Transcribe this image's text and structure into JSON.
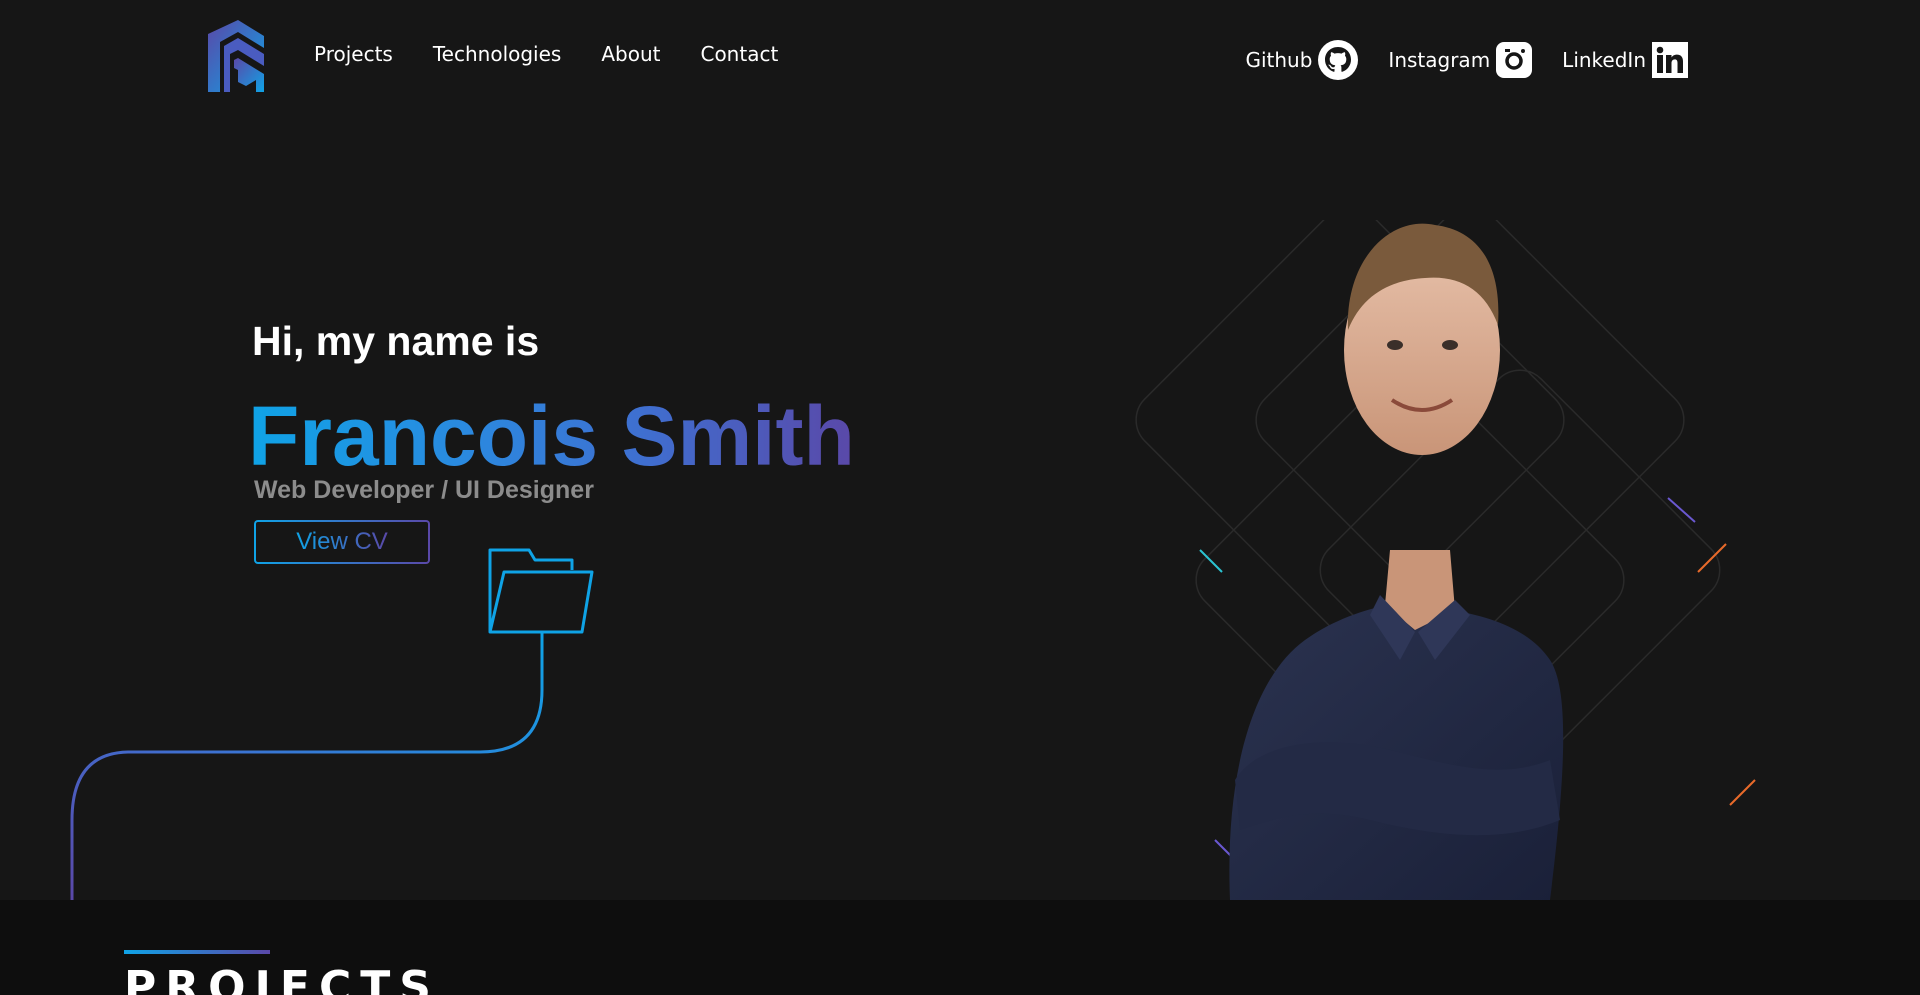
{
  "nav": {
    "items": [
      {
        "label": "Projects"
      },
      {
        "label": "Technologies"
      },
      {
        "label": "About"
      },
      {
        "label": "Contact"
      }
    ]
  },
  "social": {
    "items": [
      {
        "label": "Github",
        "icon": "github-icon"
      },
      {
        "label": "Instagram",
        "icon": "instagram-icon"
      },
      {
        "label": "LinkedIn",
        "icon": "linkedin-icon"
      }
    ]
  },
  "hero": {
    "greeting": "Hi, my name is",
    "name": "Francois Smith",
    "role": "Web Developer / UI Designer",
    "cv_button": "View CV"
  },
  "projects": {
    "heading": "PROJECTS"
  },
  "colors": {
    "background": "#161616",
    "accent_blue": "#0fa3e6",
    "accent_purple": "#5a48a8",
    "section_dark": "#0e0e0e"
  }
}
